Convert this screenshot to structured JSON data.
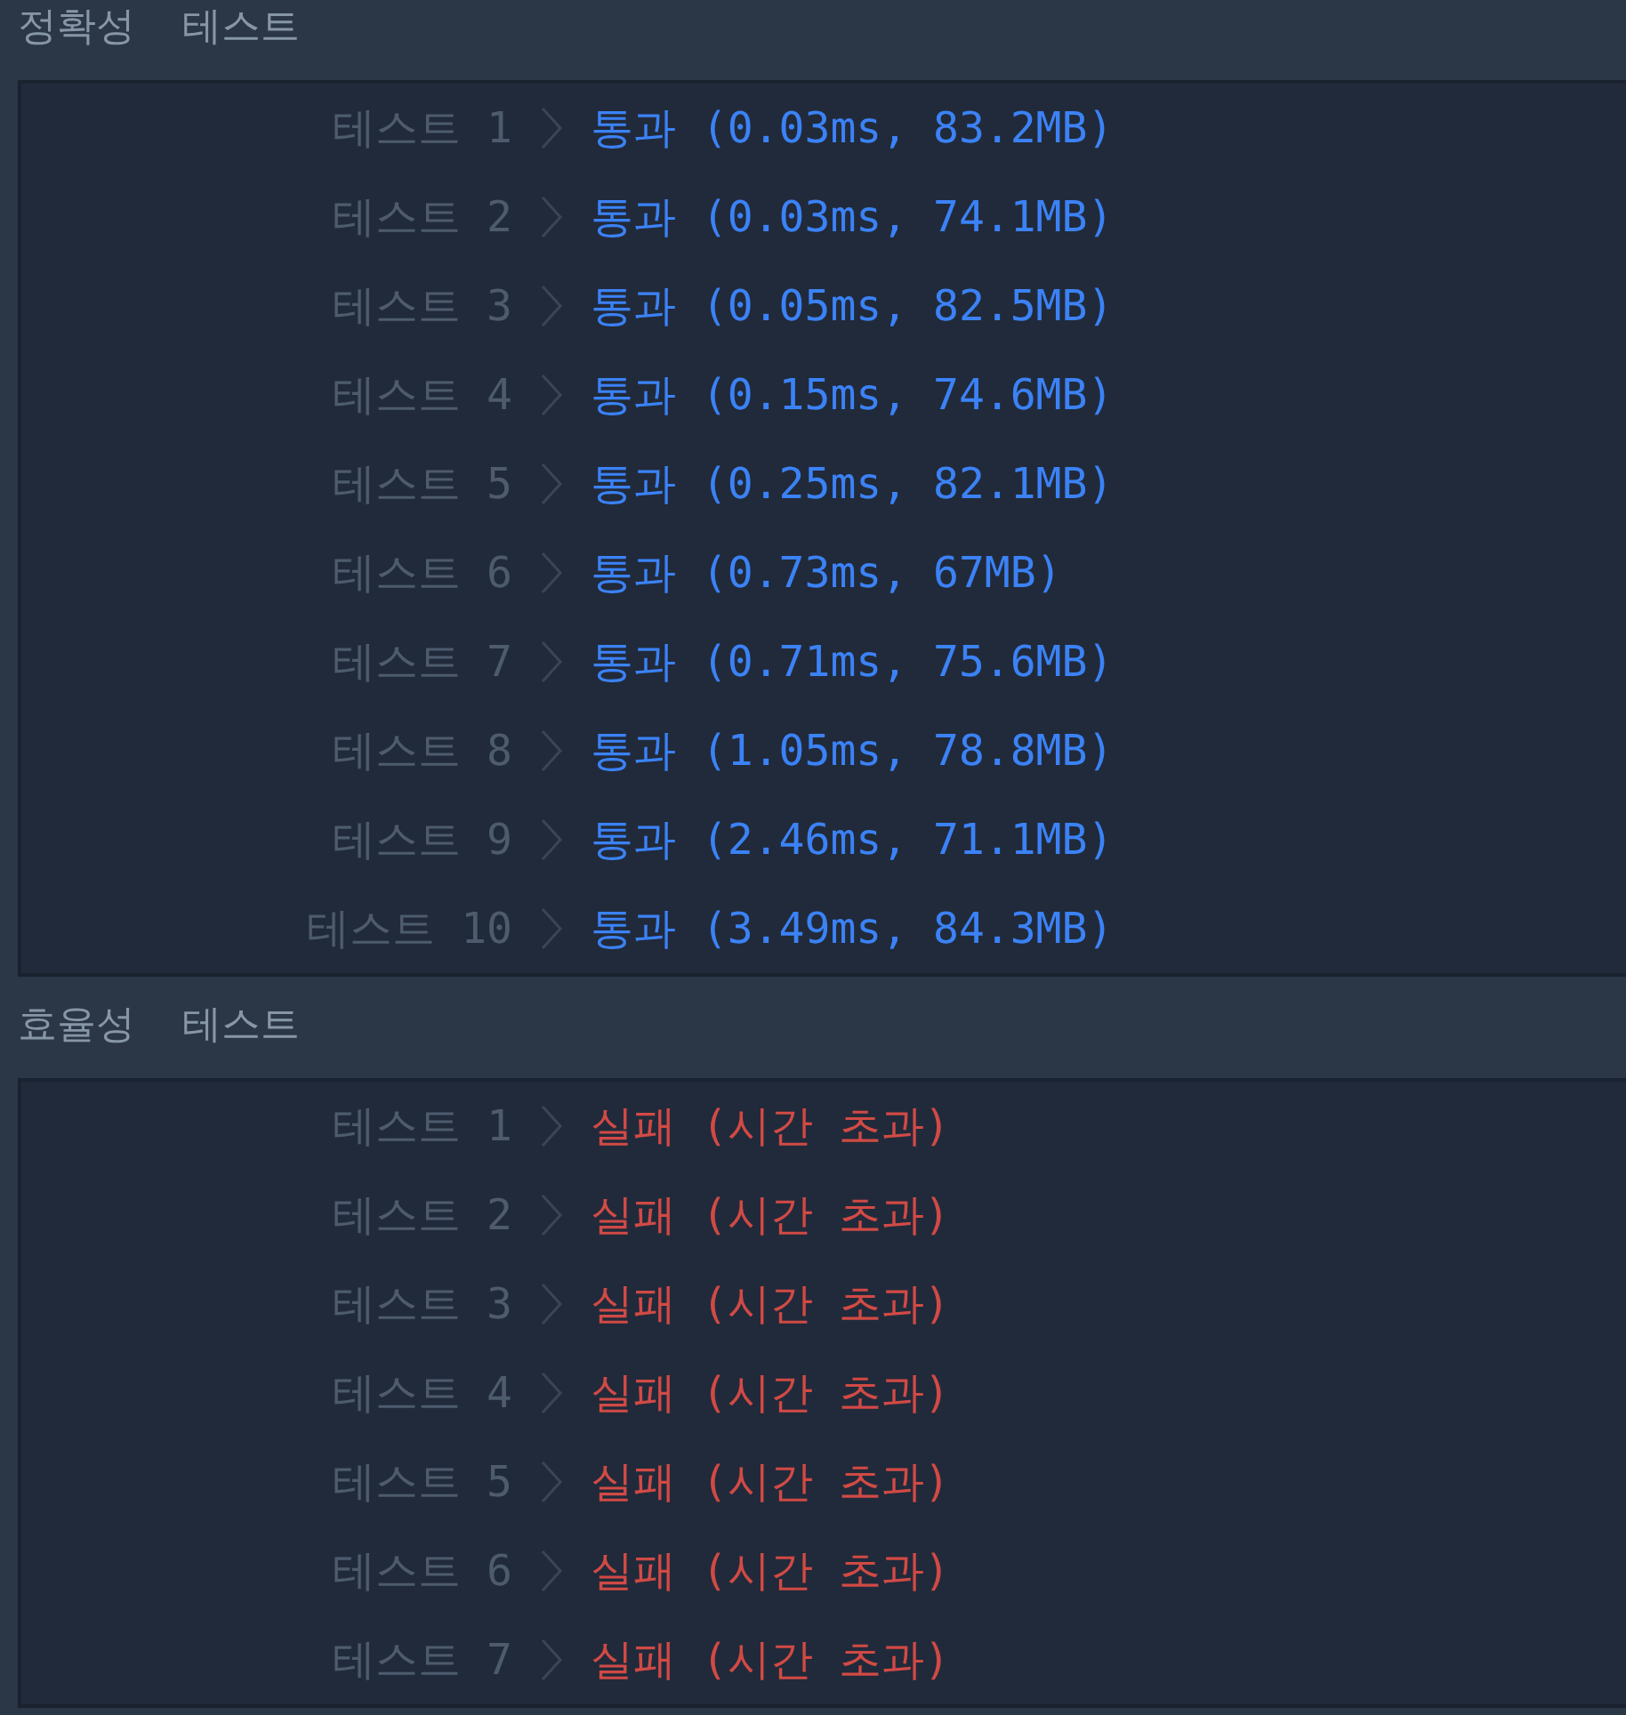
{
  "sections": [
    {
      "title": "정확성  테스트",
      "tests": [
        {
          "label": "테스트 1",
          "kind": "pass",
          "result": "통과 (0.03ms, 83.2MB)"
        },
        {
          "label": "테스트 2",
          "kind": "pass",
          "result": "통과 (0.03ms, 74.1MB)"
        },
        {
          "label": "테스트 3",
          "kind": "pass",
          "result": "통과 (0.05ms, 82.5MB)"
        },
        {
          "label": "테스트 4",
          "kind": "pass",
          "result": "통과 (0.15ms, 74.6MB)"
        },
        {
          "label": "테스트 5",
          "kind": "pass",
          "result": "통과 (0.25ms, 82.1MB)"
        },
        {
          "label": "테스트 6",
          "kind": "pass",
          "result": "통과 (0.73ms, 67MB)"
        },
        {
          "label": "테스트 7",
          "kind": "pass",
          "result": "통과 (0.71ms, 75.6MB)"
        },
        {
          "label": "테스트 8",
          "kind": "pass",
          "result": "통과 (1.05ms, 78.8MB)"
        },
        {
          "label": "테스트 9",
          "kind": "pass",
          "result": "통과 (2.46ms, 71.1MB)"
        },
        {
          "label": "테스트 10",
          "kind": "pass",
          "result": "통과 (3.49ms, 84.3MB)"
        }
      ]
    },
    {
      "title": "효율성  테스트",
      "tests": [
        {
          "label": "테스트 1",
          "kind": "fail",
          "result": "실패 (시간 초과)"
        },
        {
          "label": "테스트 2",
          "kind": "fail",
          "result": "실패 (시간 초과)"
        },
        {
          "label": "테스트 3",
          "kind": "fail",
          "result": "실패 (시간 초과)"
        },
        {
          "label": "테스트 4",
          "kind": "fail",
          "result": "실패 (시간 초과)"
        },
        {
          "label": "테스트 5",
          "kind": "fail",
          "result": "실패 (시간 초과)"
        },
        {
          "label": "테스트 6",
          "kind": "fail",
          "result": "실패 (시간 초과)"
        },
        {
          "label": "테스트 7",
          "kind": "fail",
          "result": "실패 (시간 초과)"
        }
      ]
    }
  ]
}
